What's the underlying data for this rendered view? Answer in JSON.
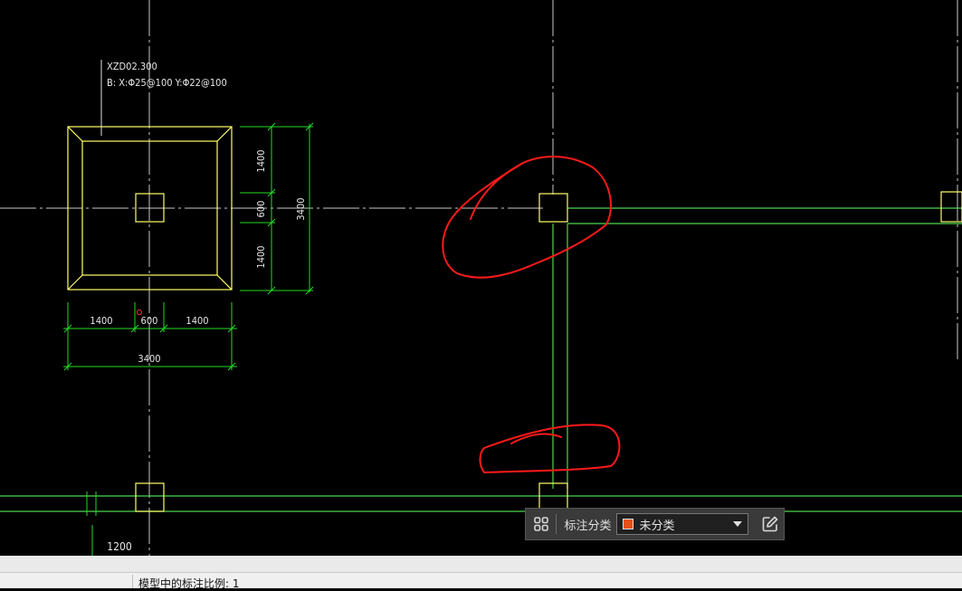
{
  "drawing": {
    "footing_label": "XZD02.300",
    "footing_rebar": "B: X:Φ25@100   Y:Φ22@100",
    "dim_vertical_upper": "1400",
    "dim_vertical_middle": "600",
    "dim_vertical_lower": "1400",
    "dim_vertical_total": "3400",
    "dim_horizontal_left": "1400",
    "dim_horizontal_middle": "600",
    "dim_horizontal_right": "1400",
    "dim_horizontal_total": "3400",
    "dim_bottom_left": "1200"
  },
  "annotation_toolbar": {
    "grid_icon": "grid-icon",
    "category_label": "标注分类",
    "category_value": "未分类",
    "category_swatch_color": "#e8501a",
    "edit_icon": "edit-icon"
  },
  "status_bar": {
    "scale_text": "模型中的标注比例: 1"
  },
  "colors": {
    "background": "#000000",
    "axis": "#c8c8c8",
    "footing": "#ffff66",
    "dimension": "#22dd22",
    "beam": "#4cd64c",
    "markup": "#ff1a1a"
  }
}
